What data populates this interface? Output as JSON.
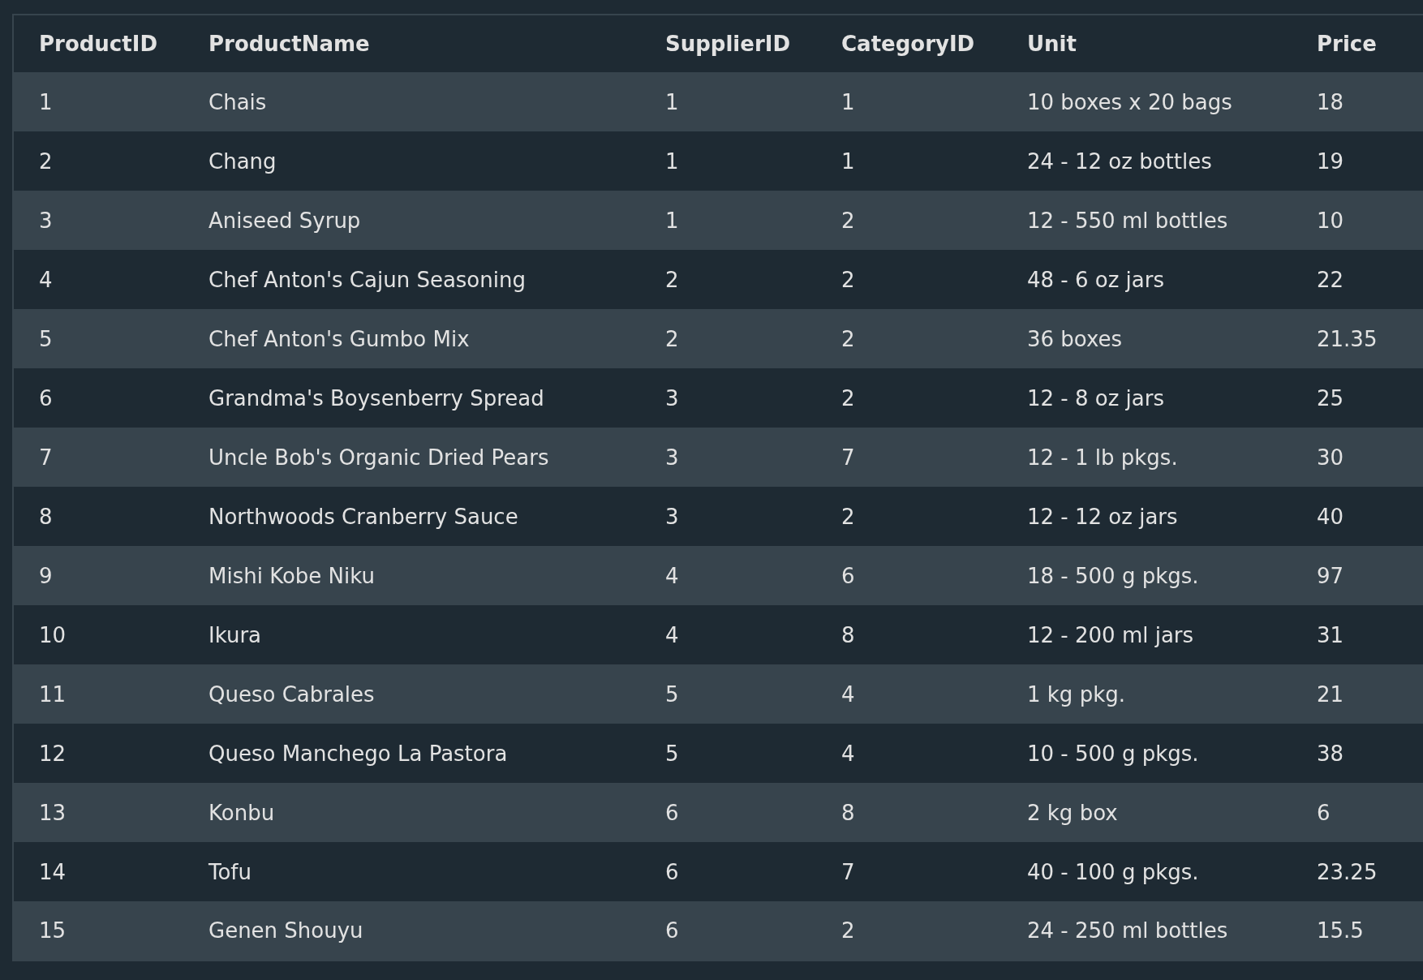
{
  "table": {
    "columns": [
      "ProductID",
      "ProductName",
      "SupplierID",
      "CategoryID",
      "Unit",
      "Price"
    ],
    "rows": [
      [
        "1",
        "Chais",
        "1",
        "1",
        "10 boxes x 20 bags",
        "18"
      ],
      [
        "2",
        "Chang",
        "1",
        "1",
        "24 - 12 oz bottles",
        "19"
      ],
      [
        "3",
        "Aniseed Syrup",
        "1",
        "2",
        "12 - 550 ml bottles",
        "10"
      ],
      [
        "4",
        "Chef Anton's Cajun Seasoning",
        "2",
        "2",
        "48 - 6 oz jars",
        "22"
      ],
      [
        "5",
        "Chef Anton's Gumbo Mix",
        "2",
        "2",
        "36 boxes",
        "21.35"
      ],
      [
        "6",
        "Grandma's Boysenberry Spread",
        "3",
        "2",
        "12 - 8 oz jars",
        "25"
      ],
      [
        "7",
        "Uncle Bob's Organic Dried Pears",
        "3",
        "7",
        "12 - 1 lb pkgs.",
        "30"
      ],
      [
        "8",
        "Northwoods Cranberry Sauce",
        "3",
        "2",
        "12 - 12 oz jars",
        "40"
      ],
      [
        "9",
        "Mishi Kobe Niku",
        "4",
        "6",
        "18 - 500 g pkgs.",
        "97"
      ],
      [
        "10",
        "Ikura",
        "4",
        "8",
        "12 - 200 ml jars",
        "31"
      ],
      [
        "11",
        "Queso Cabrales",
        "5",
        "4",
        "1 kg pkg.",
        "21"
      ],
      [
        "12",
        "Queso Manchego La Pastora",
        "5",
        "4",
        "10 - 500 g pkgs.",
        "38"
      ],
      [
        "13",
        "Konbu",
        "6",
        "8",
        "2 kg box",
        "6"
      ],
      [
        "14",
        "Tofu",
        "6",
        "7",
        "40 - 100 g pkgs.",
        "23.25"
      ],
      [
        "15",
        "Genen Shouyu",
        "6",
        "2",
        "24 - 250 ml bottles",
        "15.5"
      ]
    ]
  }
}
